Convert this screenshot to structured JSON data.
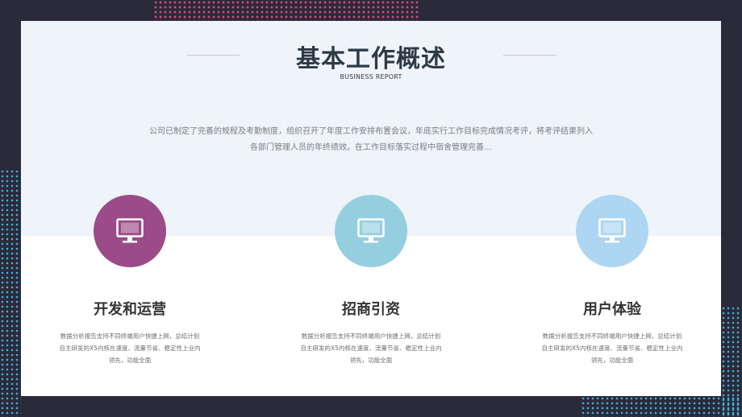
{
  "header": {
    "title": "基本工作概述",
    "subtitle": "BUSINESS REPORT"
  },
  "intro": {
    "line1": "公司已制定了完善的规程及考勤制度，组织召开了年度工作安排布置会议，年底实行工作目标完成情况考评，将考评结果列入",
    "line2": "各部门管理人员的年终绩效。在工作目标落实过程中宿舍管理完善…"
  },
  "features": [
    {
      "title": "开发和运营",
      "icon": "monitor-icon",
      "color": "#9b4b88",
      "desc": [
        "数据分析报告支持不同终端用户快捷上网，总结计划",
        "自主研发的X5内核在速度、流量节省、稳定性上业内",
        "领先，功能全面"
      ]
    },
    {
      "title": "招商引资",
      "icon": "monitor-icon",
      "color": "#95cfdf",
      "desc": [
        "数据分析报告支持不同终端用户快捷上网，总结计划",
        "自主研发的X5内核在速度、流量节省、稳定性上业内",
        "领先，功能全面"
      ]
    },
    {
      "title": "用户体验",
      "icon": "monitor-icon",
      "color": "#aed6f2",
      "desc": [
        "数据分析报告支持不同终端用户快捷上网，总结计划",
        "自主研发的X5内核在速度、流量节省、稳定性上业内",
        "领先，功能全面"
      ]
    }
  ],
  "colors": {
    "background": "#2b2a3b",
    "panel_top": "#eef4fa",
    "dots_pink": "#e0467a",
    "dots_blue": "#3fb3d6"
  }
}
